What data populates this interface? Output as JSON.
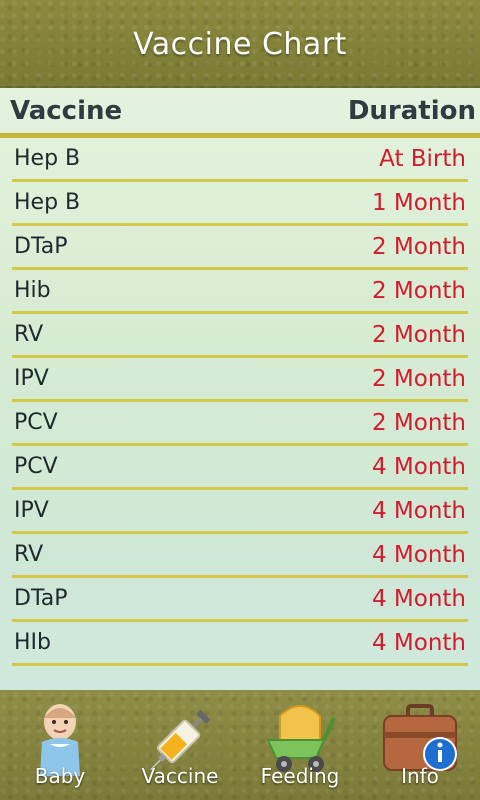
{
  "header": {
    "title": "Vaccine Chart"
  },
  "table": {
    "columns": {
      "vaccine": "Vaccine",
      "duration": "Duration"
    },
    "rows": [
      {
        "vaccine": "Hep B",
        "duration": "At Birth"
      },
      {
        "vaccine": "Hep B",
        "duration": "1 Month"
      },
      {
        "vaccine": "DTaP",
        "duration": "2 Month"
      },
      {
        "vaccine": "Hib",
        "duration": "2 Month"
      },
      {
        "vaccine": "RV",
        "duration": "2 Month"
      },
      {
        "vaccine": "IPV",
        "duration": "2 Month"
      },
      {
        "vaccine": "PCV",
        "duration": "2 Month"
      },
      {
        "vaccine": "PCV",
        "duration": "4 Month"
      },
      {
        "vaccine": "IPV",
        "duration": "4 Month"
      },
      {
        "vaccine": "RV",
        "duration": "4 Month"
      },
      {
        "vaccine": "DTaP",
        "duration": "4 Month"
      },
      {
        "vaccine": "HIb",
        "duration": "4 Month"
      }
    ]
  },
  "nav": {
    "items": [
      {
        "label": "Baby",
        "icon": "baby-icon"
      },
      {
        "label": "Vaccine",
        "icon": "syringe-icon"
      },
      {
        "label": "Feeding",
        "icon": "stroller-icon"
      },
      {
        "label": "Info",
        "icon": "briefcase-info-icon"
      }
    ],
    "active": "Vaccine"
  },
  "colors": {
    "header_bg": "#7f7d38",
    "duration_text": "#d41b2d",
    "row_divider": "#d3c84c"
  }
}
